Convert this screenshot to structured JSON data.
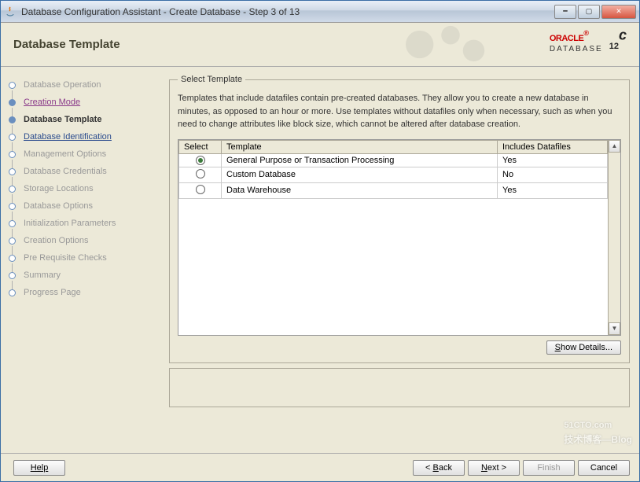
{
  "window": {
    "title": "Database Configuration Assistant - Create Database - Step 3 of 13"
  },
  "header": {
    "title": "Database Template",
    "brand": "ORACLE",
    "brand_sub": "DATABASE",
    "version": "12",
    "version_suffix": "c"
  },
  "sidebar": {
    "items": [
      {
        "label": "Database Operation",
        "state": "disabled"
      },
      {
        "label": "Creation Mode",
        "state": "done link"
      },
      {
        "label": "Database Template",
        "state": "active"
      },
      {
        "label": "Database Identification",
        "state": "link"
      },
      {
        "label": "Management Options",
        "state": "disabled"
      },
      {
        "label": "Database Credentials",
        "state": "disabled"
      },
      {
        "label": "Storage Locations",
        "state": "disabled"
      },
      {
        "label": "Database Options",
        "state": "disabled"
      },
      {
        "label": "Initialization Parameters",
        "state": "disabled"
      },
      {
        "label": "Creation Options",
        "state": "disabled"
      },
      {
        "label": "Pre Requisite Checks",
        "state": "disabled"
      },
      {
        "label": "Summary",
        "state": "disabled"
      },
      {
        "label": "Progress Page",
        "state": "disabled"
      }
    ]
  },
  "panel": {
    "legend": "Select Template",
    "description": "Templates that include datafiles contain pre-created databases. They allow you to create a new database in minutes, as opposed to an hour or more. Use templates without datafiles only when necessary, such as when you need to change attributes like block size, which cannot be altered after database creation.",
    "columns": {
      "select": "Select",
      "template": "Template",
      "includes": "Includes Datafiles"
    },
    "rows": [
      {
        "selected": true,
        "template": "General Purpose or Transaction Processing",
        "includes": "Yes"
      },
      {
        "selected": false,
        "template": "Custom Database",
        "includes": "No"
      },
      {
        "selected": false,
        "template": "Data Warehouse",
        "includes": "Yes"
      }
    ],
    "show_details": "Show Details..."
  },
  "footer": {
    "help": "Help",
    "back": "< Back",
    "next": "Next >",
    "finish": "Finish",
    "cancel": "Cancel"
  },
  "watermark": {
    "main": "51CTO.com",
    "sub": "技术博客—Blog"
  }
}
